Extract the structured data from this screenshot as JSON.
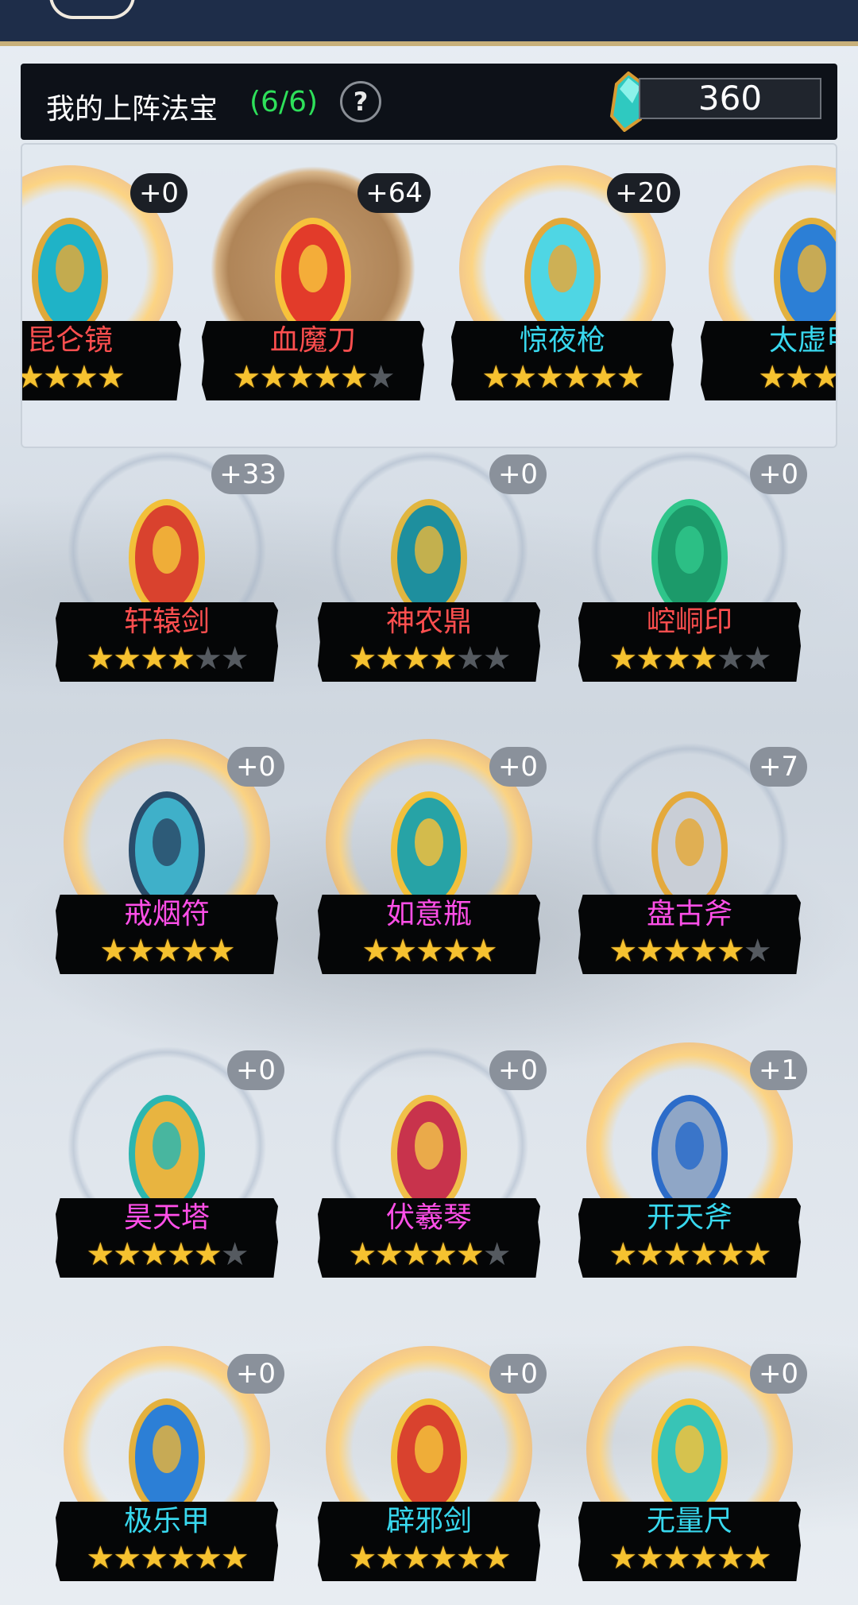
{
  "header": {
    "title": "我的上阵法宝",
    "count": "(6/6)",
    "help": "?",
    "currency": "360"
  },
  "equipped": [
    {
      "name": "昆仑镜",
      "level": "+0",
      "stars": 4,
      "max": 4,
      "color": "red",
      "halo": "gold",
      "icon": "mirror-icon"
    },
    {
      "name": "血魔刀",
      "level": "+64",
      "stars": 5,
      "max": 6,
      "color": "red",
      "halo": "bronze",
      "icon": "blade-icon"
    },
    {
      "name": "惊夜枪",
      "level": "+20",
      "stars": 6,
      "max": 6,
      "color": "cyan",
      "halo": "gold",
      "icon": "spear-icon"
    },
    {
      "name": "太虚甲",
      "level": "",
      "stars": 4,
      "max": 4,
      "color": "cyan",
      "halo": "gold",
      "icon": "armor-icon"
    }
  ],
  "items": [
    {
      "name": "轩辕剑",
      "level": "+33",
      "stars": 4,
      "max": 6,
      "color": "red",
      "halo": "plain",
      "icon": "sword-icon"
    },
    {
      "name": "神农鼎",
      "level": "+0",
      "stars": 4,
      "max": 6,
      "color": "red",
      "halo": "plain",
      "icon": "cauldron-icon"
    },
    {
      "name": "崆峒印",
      "level": "+0",
      "stars": 4,
      "max": 6,
      "color": "red",
      "halo": "plain",
      "icon": "seal-icon"
    },
    {
      "name": "戒烟符",
      "level": "+0",
      "stars": 5,
      "max": 5,
      "color": "mag",
      "halo": "gold",
      "icon": "talisman-icon"
    },
    {
      "name": "如意瓶",
      "level": "+0",
      "stars": 5,
      "max": 5,
      "color": "mag",
      "halo": "gold",
      "icon": "vase-icon"
    },
    {
      "name": "盘古斧",
      "level": "+7",
      "stars": 5,
      "max": 6,
      "color": "mag",
      "halo": "plain",
      "icon": "axe-icon"
    },
    {
      "name": "昊天塔",
      "level": "+0",
      "stars": 5,
      "max": 6,
      "color": "mag",
      "halo": "plain",
      "icon": "tower-icon"
    },
    {
      "name": "伏羲琴",
      "level": "+0",
      "stars": 5,
      "max": 6,
      "color": "mag",
      "halo": "plain",
      "icon": "zither-icon"
    },
    {
      "name": "开天斧",
      "level": "+1",
      "stars": 6,
      "max": 6,
      "color": "cyan",
      "halo": "gold",
      "icon": "battle-axe-icon"
    },
    {
      "name": "极乐甲",
      "level": "+0",
      "stars": 6,
      "max": 6,
      "color": "cyan",
      "halo": "gold",
      "icon": "armor-icon"
    },
    {
      "name": "辟邪剑",
      "level": "+0",
      "stars": 6,
      "max": 6,
      "color": "cyan",
      "halo": "gold",
      "icon": "sword-icon"
    },
    {
      "name": "无量尺",
      "level": "+0",
      "stars": 6,
      "max": 6,
      "color": "cyan",
      "halo": "gold",
      "icon": "ruler-icon"
    }
  ],
  "colors": {
    "red": "#ff4f4f",
    "cyan": "#38d8ee",
    "mag": "#ff4fe8",
    "star": "#f6c230",
    "count": "#2ee05a"
  }
}
